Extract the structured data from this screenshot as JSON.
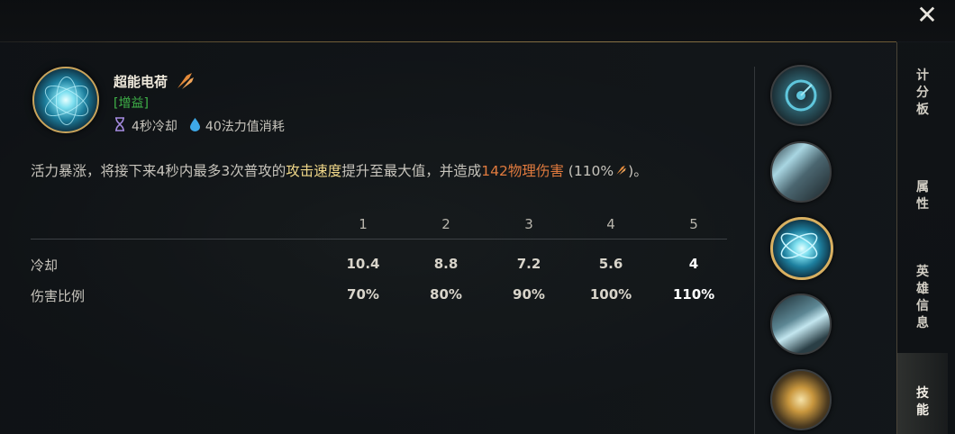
{
  "close_label": "✕",
  "skill": {
    "name": "超能电荷",
    "tag": "[增益]",
    "cooldown": "4秒冷却",
    "cost": "40法力值消耗",
    "desc_pre": "活力暴涨，将接下来4秒内最多3次普攻的",
    "desc_hl1": "攻击速度",
    "desc_mid": "提升至最大值，并造成",
    "desc_hl2": "142物理伤害",
    "desc_ratio_open": " (110%",
    "desc_end": ")。"
  },
  "table": {
    "levels": [
      "1",
      "2",
      "3",
      "4",
      "5"
    ],
    "rows": [
      {
        "label": "冷却",
        "values": [
          "10.4",
          "8.8",
          "7.2",
          "5.6",
          "4"
        ]
      },
      {
        "label": "伤害比例",
        "values": [
          "70%",
          "80%",
          "90%",
          "100%",
          "110%"
        ]
      }
    ]
  },
  "skill_icons": [
    "passive-icon",
    "spear-icon",
    "energy-orb-icon",
    "dash-icon",
    "ultimate-icon"
  ],
  "sidebar": {
    "tabs": [
      "计分板",
      "属性",
      "英雄信息",
      "技能"
    ],
    "active": "技能"
  },
  "colors": {
    "accent_gold": "#d8b061",
    "buff_green": "#3fb449",
    "highlight_yellow": "#f1d889",
    "damage_orange": "#e07a3e"
  }
}
